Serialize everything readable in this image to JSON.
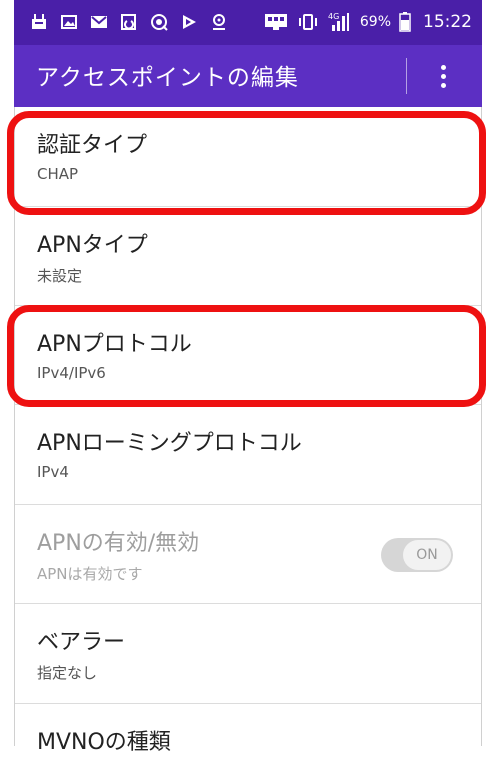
{
  "status_bar": {
    "left_icons": [
      "store-icon",
      "image-icon",
      "gmail-icon",
      "sync-icon",
      "browser-icon",
      "play-store-icon",
      "location-icon"
    ],
    "right_icons": [
      "screen-mirror-icon",
      "vibrate-icon",
      "signal-4g-icon"
    ],
    "network_label": "4G",
    "battery_percent": "69%",
    "time": "15:22"
  },
  "app_bar": {
    "title": "アクセスポイントの編集",
    "more_icon": "more-vert-icon"
  },
  "settings": [
    {
      "title": "認証タイプ",
      "subtitle": "CHAP"
    },
    {
      "title": "APNタイプ",
      "subtitle": "未設定"
    },
    {
      "title": "APNプロトコル",
      "subtitle": "IPv4/IPv6"
    },
    {
      "title": "APNローミングプロトコル",
      "subtitle": "IPv4"
    },
    {
      "title": "APNの有効/無効",
      "subtitle": "APNは有効です",
      "toggle_label": "ON",
      "enabled": false
    },
    {
      "title": "ベアラー",
      "subtitle": "指定なし"
    },
    {
      "title": "MVNOの種類",
      "subtitle": ""
    }
  ],
  "colors": {
    "status_bar": "#4a1fa8",
    "app_bar": "#5c2fc3",
    "highlight": "#ee1111"
  }
}
